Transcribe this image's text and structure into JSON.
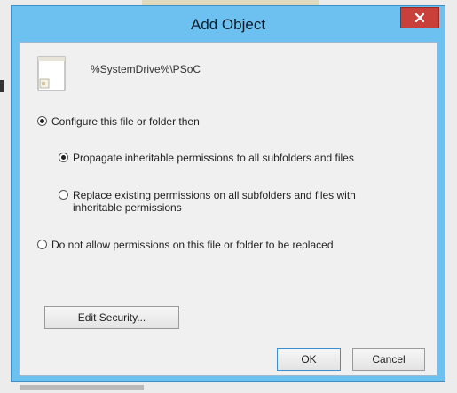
{
  "dialog": {
    "title": "Add Object",
    "close_label": "x",
    "path": "%SystemDrive%\\PSoC"
  },
  "options": {
    "configure": "Configure this file or folder then",
    "propagate": "Propagate inheritable permissions to all subfolders and files",
    "replace_line1": "Replace existing permissions on all subfolders and files with",
    "replace_line2": "inheritable permissions",
    "do_not_allow": "Do not allow permissions on this file or folder to be replaced"
  },
  "state": {
    "configure_selected": true,
    "propagate_selected": true,
    "replace_selected": false,
    "do_not_allow_selected": false
  },
  "buttons": {
    "edit_security": "Edit Security...",
    "ok": "OK",
    "cancel": "Cancel"
  },
  "colors": {
    "titlebar": "#6cc1f0",
    "close": "#c9403a"
  },
  "icons": {
    "file": "file-icon",
    "close": "close-icon"
  }
}
